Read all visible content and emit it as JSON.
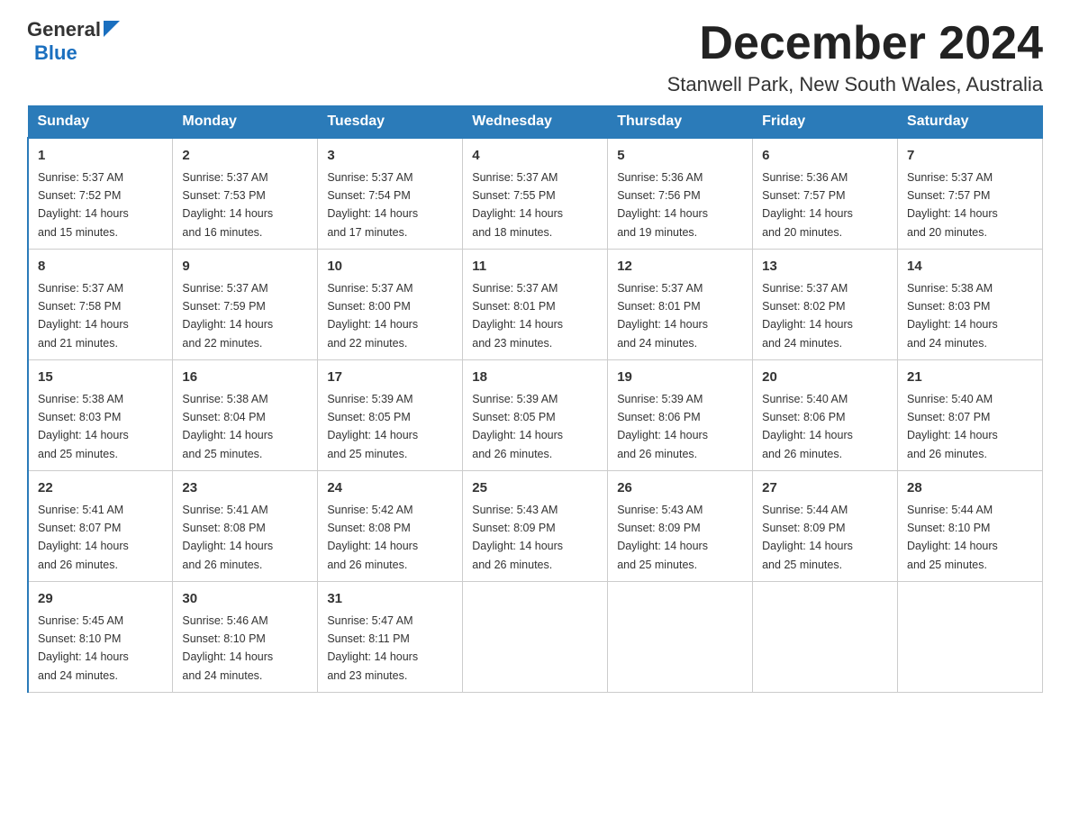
{
  "header": {
    "logo_line1": "General",
    "logo_line2": "Blue",
    "month_title": "December 2024",
    "location": "Stanwell Park, New South Wales, Australia"
  },
  "weekdays": [
    "Sunday",
    "Monday",
    "Tuesday",
    "Wednesday",
    "Thursday",
    "Friday",
    "Saturday"
  ],
  "weeks": [
    [
      {
        "day": "1",
        "sunrise": "5:37 AM",
        "sunset": "7:52 PM",
        "daylight": "14 hours and 15 minutes."
      },
      {
        "day": "2",
        "sunrise": "5:37 AM",
        "sunset": "7:53 PM",
        "daylight": "14 hours and 16 minutes."
      },
      {
        "day": "3",
        "sunrise": "5:37 AM",
        "sunset": "7:54 PM",
        "daylight": "14 hours and 17 minutes."
      },
      {
        "day": "4",
        "sunrise": "5:37 AM",
        "sunset": "7:55 PM",
        "daylight": "14 hours and 18 minutes."
      },
      {
        "day": "5",
        "sunrise": "5:36 AM",
        "sunset": "7:56 PM",
        "daylight": "14 hours and 19 minutes."
      },
      {
        "day": "6",
        "sunrise": "5:36 AM",
        "sunset": "7:57 PM",
        "daylight": "14 hours and 20 minutes."
      },
      {
        "day": "7",
        "sunrise": "5:37 AM",
        "sunset": "7:57 PM",
        "daylight": "14 hours and 20 minutes."
      }
    ],
    [
      {
        "day": "8",
        "sunrise": "5:37 AM",
        "sunset": "7:58 PM",
        "daylight": "14 hours and 21 minutes."
      },
      {
        "day": "9",
        "sunrise": "5:37 AM",
        "sunset": "7:59 PM",
        "daylight": "14 hours and 22 minutes."
      },
      {
        "day": "10",
        "sunrise": "5:37 AM",
        "sunset": "8:00 PM",
        "daylight": "14 hours and 22 minutes."
      },
      {
        "day": "11",
        "sunrise": "5:37 AM",
        "sunset": "8:01 PM",
        "daylight": "14 hours and 23 minutes."
      },
      {
        "day": "12",
        "sunrise": "5:37 AM",
        "sunset": "8:01 PM",
        "daylight": "14 hours and 24 minutes."
      },
      {
        "day": "13",
        "sunrise": "5:37 AM",
        "sunset": "8:02 PM",
        "daylight": "14 hours and 24 minutes."
      },
      {
        "day": "14",
        "sunrise": "5:38 AM",
        "sunset": "8:03 PM",
        "daylight": "14 hours and 24 minutes."
      }
    ],
    [
      {
        "day": "15",
        "sunrise": "5:38 AM",
        "sunset": "8:03 PM",
        "daylight": "14 hours and 25 minutes."
      },
      {
        "day": "16",
        "sunrise": "5:38 AM",
        "sunset": "8:04 PM",
        "daylight": "14 hours and 25 minutes."
      },
      {
        "day": "17",
        "sunrise": "5:39 AM",
        "sunset": "8:05 PM",
        "daylight": "14 hours and 25 minutes."
      },
      {
        "day": "18",
        "sunrise": "5:39 AM",
        "sunset": "8:05 PM",
        "daylight": "14 hours and 26 minutes."
      },
      {
        "day": "19",
        "sunrise": "5:39 AM",
        "sunset": "8:06 PM",
        "daylight": "14 hours and 26 minutes."
      },
      {
        "day": "20",
        "sunrise": "5:40 AM",
        "sunset": "8:06 PM",
        "daylight": "14 hours and 26 minutes."
      },
      {
        "day": "21",
        "sunrise": "5:40 AM",
        "sunset": "8:07 PM",
        "daylight": "14 hours and 26 minutes."
      }
    ],
    [
      {
        "day": "22",
        "sunrise": "5:41 AM",
        "sunset": "8:07 PM",
        "daylight": "14 hours and 26 minutes."
      },
      {
        "day": "23",
        "sunrise": "5:41 AM",
        "sunset": "8:08 PM",
        "daylight": "14 hours and 26 minutes."
      },
      {
        "day": "24",
        "sunrise": "5:42 AM",
        "sunset": "8:08 PM",
        "daylight": "14 hours and 26 minutes."
      },
      {
        "day": "25",
        "sunrise": "5:43 AM",
        "sunset": "8:09 PM",
        "daylight": "14 hours and 26 minutes."
      },
      {
        "day": "26",
        "sunrise": "5:43 AM",
        "sunset": "8:09 PM",
        "daylight": "14 hours and 25 minutes."
      },
      {
        "day": "27",
        "sunrise": "5:44 AM",
        "sunset": "8:09 PM",
        "daylight": "14 hours and 25 minutes."
      },
      {
        "day": "28",
        "sunrise": "5:44 AM",
        "sunset": "8:10 PM",
        "daylight": "14 hours and 25 minutes."
      }
    ],
    [
      {
        "day": "29",
        "sunrise": "5:45 AM",
        "sunset": "8:10 PM",
        "daylight": "14 hours and 24 minutes."
      },
      {
        "day": "30",
        "sunrise": "5:46 AM",
        "sunset": "8:10 PM",
        "daylight": "14 hours and 24 minutes."
      },
      {
        "day": "31",
        "sunrise": "5:47 AM",
        "sunset": "8:11 PM",
        "daylight": "14 hours and 23 minutes."
      },
      null,
      null,
      null,
      null
    ]
  ],
  "labels": {
    "sunrise": "Sunrise:",
    "sunset": "Sunset:",
    "daylight": "Daylight:"
  }
}
